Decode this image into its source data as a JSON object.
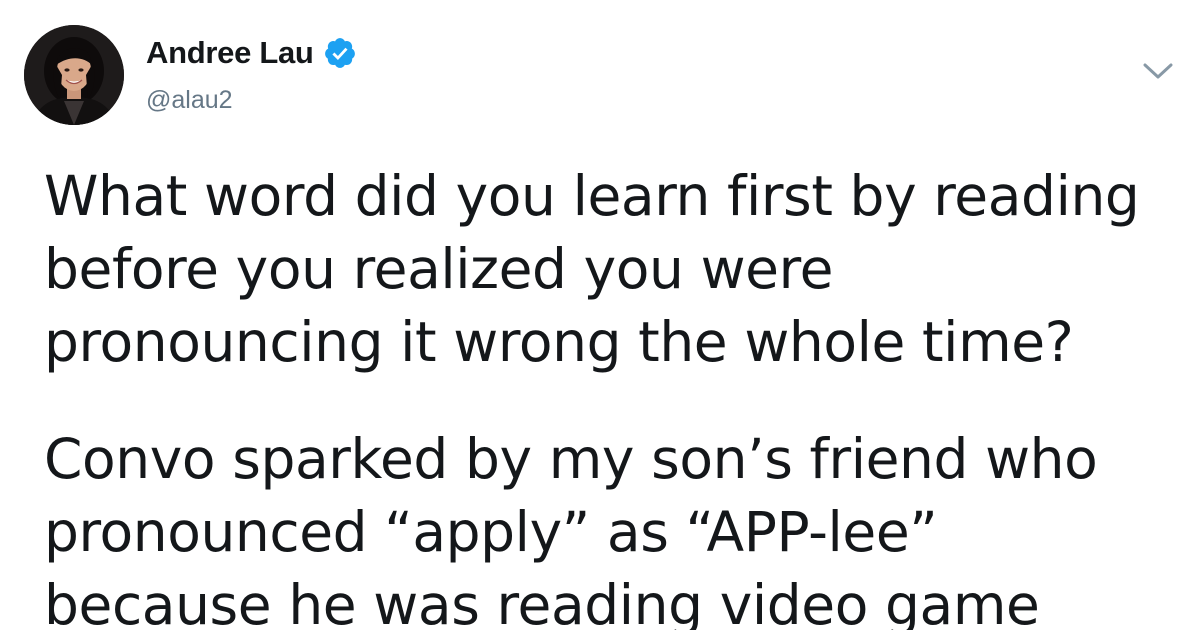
{
  "user": {
    "display_name": "Andree Lau",
    "handle": "@alau2",
    "verified": true,
    "avatar_icon": "profile-photo"
  },
  "menu": {
    "caret_icon": "chevron-down-icon"
  },
  "tweet": {
    "paragraphs": [
      {
        "lines": [
          "What word did you learn first by reading",
          "before you realized you were",
          "pronouncing it wrong the whole time?"
        ]
      },
      {
        "lines": [
          "Convo sparked by my son’s friend who",
          "pronounced “apply” as “APP-lee”",
          "because he was reading video game"
        ]
      }
    ]
  },
  "colors": {
    "text": "#14171a",
    "secondary": "#657786",
    "verified_badge": "#1da1f2",
    "background": "#ffffff"
  }
}
